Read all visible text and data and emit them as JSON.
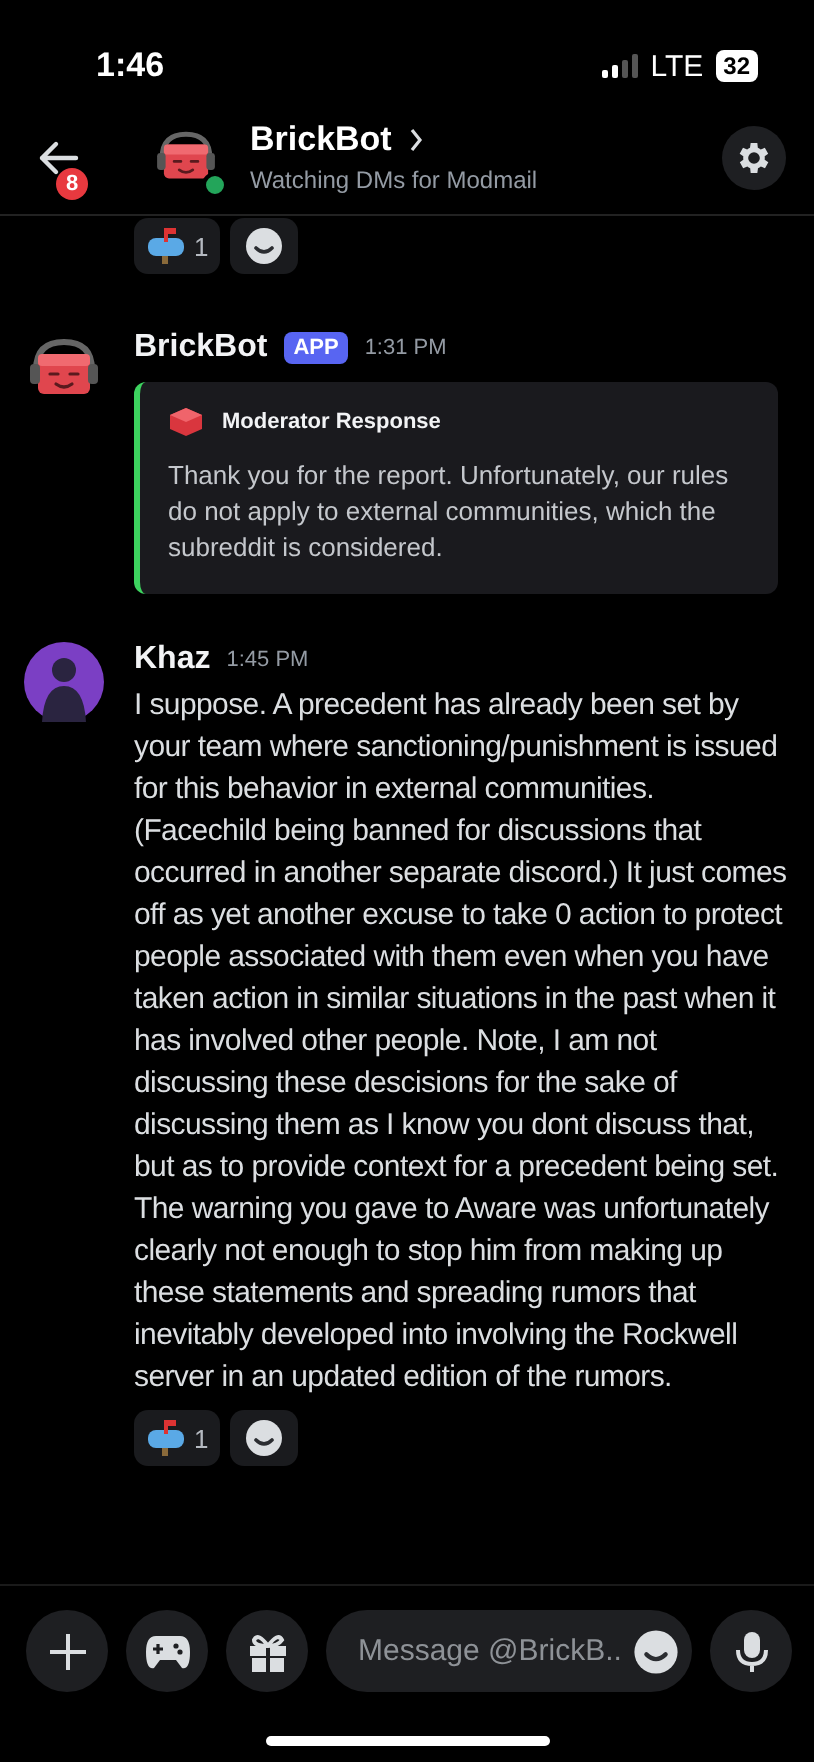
{
  "status_bar": {
    "time": "1:46",
    "network": "LTE",
    "battery": "32"
  },
  "header": {
    "unread_badge": "8",
    "title": "BrickBot",
    "subtitle": "Watching DMs for Modmail",
    "online": true
  },
  "previous_message": {
    "reactions": [
      {
        "count": "1"
      }
    ]
  },
  "messages": [
    {
      "kind": "embed",
      "author": "BrickBot",
      "tag": "APP",
      "time": "1:31 PM",
      "embed": {
        "title": "Moderator Response",
        "text": "Thank you for the report. Unfortunately, our rules do not apply to external communities, which the subreddit is considered."
      }
    },
    {
      "kind": "text",
      "author": "Khaz",
      "time": "1:45 PM",
      "text": "I suppose. A precedent has already been set by your team where sanctioning/punishment is issued for this behavior in external communities. (Facechild being banned for discussions that occurred in another separate discord.) It just comes off as yet another excuse to take 0 action to protect people associated with them even when you have taken action in similar situations in the past when it has involved other people. Note, I am not discussing these descisions for the sake of discussing them as I know you dont discuss that, but as to provide context for a precedent being set. The warning you gave to Aware was  unfortunately clearly not enough to stop him from making up these statements and spreading rumors that inevitably developed into involving the Rockwell server in an updated edition of the rumors.",
      "reactions": [
        {
          "count": "1"
        }
      ]
    }
  ],
  "composer": {
    "placeholder": "Message @BrickB.."
  }
}
